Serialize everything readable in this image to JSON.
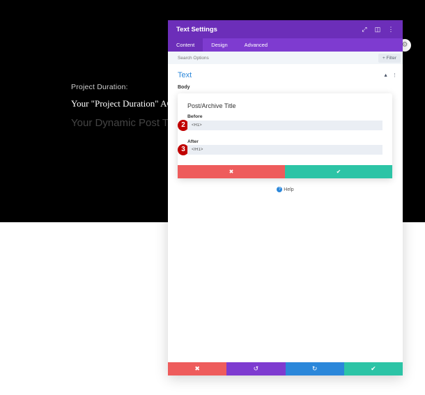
{
  "hero": {
    "label": "Project Duration:",
    "title": "Your \"Project Duration\" AC",
    "subtitle": "Your Dynamic Post Ti"
  },
  "panel": {
    "title": "Text Settings",
    "header_icons": [
      "resize-icon",
      "sidebar-icon",
      "more-icon"
    ],
    "tabs": [
      {
        "label": "Content",
        "active": true
      },
      {
        "label": "Design",
        "active": false
      },
      {
        "label": "Advanced",
        "active": false
      }
    ],
    "search_placeholder": "Search Options",
    "filter_label": "+ Filter",
    "section_title": "Text",
    "body_label": "Body",
    "help_label": "Help"
  },
  "card": {
    "title": "Post/Archive Title",
    "before_label": "Before",
    "before_value": "<H1>",
    "after_label": "After",
    "after_value": "</H1>",
    "step_before": "2",
    "step_after": "3"
  },
  "colors": {
    "header_purple": "#6c2eb9",
    "tab_purple": "#7e3bd0",
    "cancel_red": "#ee5c5c",
    "ok_green": "#2cc4a6",
    "undo_purple": "#7e3bd0",
    "redo_blue": "#2b87da",
    "step_red": "#c00000"
  }
}
